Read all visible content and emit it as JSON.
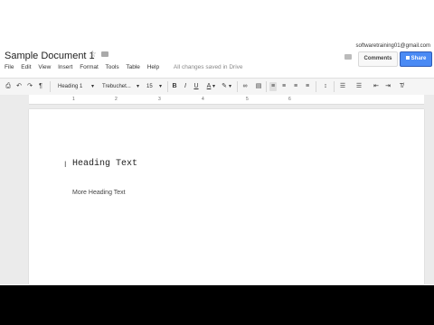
{
  "header": {
    "doc_title": "Sample Document 1",
    "star_icon": "☆",
    "account_email": "softwaretraining01@gmail.com",
    "comments_label": "Comments",
    "share_label": "Share"
  },
  "menu": {
    "items": [
      "File",
      "Edit",
      "View",
      "Insert",
      "Format",
      "Tools",
      "Table",
      "Help"
    ],
    "saved_status": "All changes saved in Drive"
  },
  "toolbar": {
    "print_icon": "⎙",
    "undo_icon": "↶",
    "redo_icon": "↷",
    "paint_icon": "¶",
    "style_value": "Heading 1",
    "font_value": "Trebuchet...",
    "size_value": "15",
    "bold": "B",
    "italic": "I",
    "underline": "U",
    "text_color": "A",
    "highlight": "✎",
    "link_icon": "∞",
    "comment_icon": "▤",
    "align_left": "≡",
    "align_center": "≡",
    "align_right": "≡",
    "justify": "≡",
    "line_spacing": "↕",
    "numbered_list": "☰",
    "bulleted_list": "☰",
    "decrease_indent": "⇤",
    "increase_indent": "⇥",
    "clear_format": "T̸",
    "dropdown_arrow": "▾"
  },
  "ruler": {
    "marks": [
      "1",
      "2",
      "3",
      "4",
      "5",
      "6"
    ]
  },
  "document": {
    "cursor_glyph": "I",
    "heading": "Heading Text",
    "subheading": "More Heading Text"
  }
}
